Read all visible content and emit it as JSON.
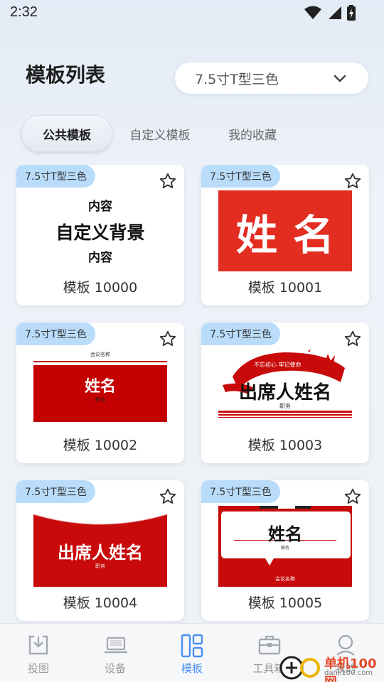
{
  "status": {
    "time": "2:32"
  },
  "header": {
    "title": "模板列表",
    "model_select": "7.5寸T型三色"
  },
  "tabs": [
    {
      "label": "公共模板",
      "active": true
    },
    {
      "label": "自定义模板",
      "active": false
    },
    {
      "label": "我的收藏",
      "active": false
    }
  ],
  "cards": [
    {
      "badge": "7.5寸T型三色",
      "caption": "模板 10000",
      "preview": {
        "line1": "内容",
        "line2": "自定义背景",
        "line3": "内容"
      }
    },
    {
      "badge": "7.5寸T型三色",
      "caption": "模板 10001",
      "preview": {
        "name": "姓名"
      }
    },
    {
      "badge": "7.5寸T型三色",
      "caption": "模板 10002",
      "preview": {
        "top": "会议名称",
        "name": "姓名",
        "sub": "职务"
      }
    },
    {
      "badge": "7.5寸T型三色",
      "caption": "模板 10003",
      "preview": {
        "slogan": "不忘初心 牢记使命",
        "name": "出席人姓名",
        "role": "职务"
      }
    },
    {
      "badge": "7.5寸T型三色",
      "caption": "模板 10004",
      "preview": {
        "name": "出席人姓名",
        "sub": "职务"
      }
    },
    {
      "badge": "7.5寸T型三色",
      "caption": "模板 10005",
      "preview": {
        "name": "姓名",
        "sub": "职务",
        "meeting": "会议名称"
      }
    }
  ],
  "bottom_nav": [
    {
      "label": "投图",
      "icon": "download-tray-icon",
      "active": false
    },
    {
      "label": "设备",
      "icon": "laptop-icon",
      "active": false
    },
    {
      "label": "模板",
      "icon": "template-grid-icon",
      "active": true
    },
    {
      "label": "工具箱",
      "icon": "toolbox-icon",
      "active": false
    },
    {
      "label": "我的",
      "icon": "user-icon",
      "active": false
    }
  ],
  "watermark": {
    "text": "单机100网",
    "url": "danji100.com"
  },
  "colors": {
    "accent": "#4a8ff3",
    "badge": "#b9dcfb",
    "template_red": "#e32d20"
  }
}
